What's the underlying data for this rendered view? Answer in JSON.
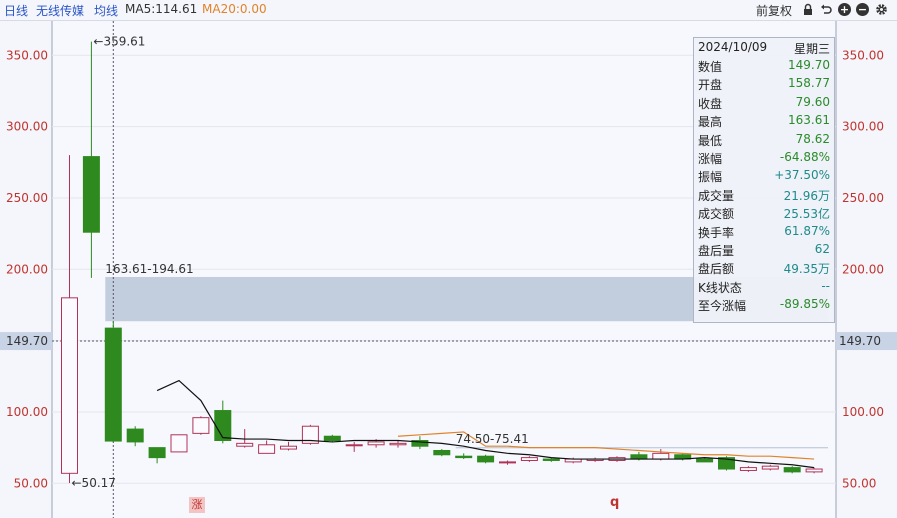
{
  "toolbar": {
    "period": "日线",
    "stock_name": "无线传媒",
    "avg_line": "均线",
    "ma5": "MA5:114.61",
    "ma20": "MA20:0.00",
    "adjust": "前复权"
  },
  "icons": [
    "lock-icon",
    "undo-icon",
    "zoom-in-icon",
    "zoom-out-icon",
    "settings-gear-icon"
  ],
  "info_panel": {
    "date": "2024/10/09",
    "weekday": "星期三",
    "rows": [
      {
        "label": "数值",
        "value": "149.70",
        "color": "#2b8a2b"
      },
      {
        "label": "开盘",
        "value": "158.77",
        "color": "#2b8a2b"
      },
      {
        "label": "收盘",
        "value": "79.60",
        "color": "#2b8a2b"
      },
      {
        "label": "最高",
        "value": "163.61",
        "color": "#2b8a2b"
      },
      {
        "label": "最低",
        "value": "78.62",
        "color": "#2b8a2b"
      },
      {
        "label": "涨幅",
        "value": "-64.88%",
        "color": "#2b8a2b"
      },
      {
        "label": "振幅",
        "value": "+37.50%",
        "color": "#1f8a8a"
      },
      {
        "label": "成交量",
        "value": "21.96万",
        "color": "#1f8a8a"
      },
      {
        "label": "成交额",
        "value": "25.53亿",
        "color": "#1f8a8a"
      },
      {
        "label": "换手率",
        "value": "61.87%",
        "color": "#1f8a8a"
      },
      {
        "label": "盘后量",
        "value": "62",
        "color": "#1f8a8a"
      },
      {
        "label": "盘后额",
        "value": "49.35万",
        "color": "#1f8a8a"
      },
      {
        "label": "K线状态",
        "value": "--",
        "color": "#1f8a8a"
      },
      {
        "label": "至今涨幅",
        "value": "-89.85%",
        "color": "#2b8a2b"
      }
    ]
  },
  "markers": {
    "badge": "涨",
    "q": "q"
  },
  "chart_data": {
    "type": "candlestick",
    "y_ticks": [
      50,
      100,
      150,
      200,
      250,
      300,
      350
    ],
    "y_tick_labels": [
      "50.00",
      "100.00",
      "150.00",
      "200.00",
      "250.00",
      "300.00",
      "350.00"
    ],
    "ylim": [
      41,
      372
    ],
    "grid": true,
    "up_color": "#b03357",
    "down_color": "#2e8a1f",
    "candles": [
      {
        "o": 57,
        "h": 280,
        "l": 50.17,
        "c": 180
      },
      {
        "o": 279,
        "h": 359.61,
        "l": 194,
        "c": 226
      },
      {
        "o": 158.77,
        "h": 163.61,
        "l": 78.62,
        "c": 79.6
      },
      {
        "o": 88,
        "h": 90,
        "l": 76,
        "c": 79
      },
      {
        "o": 75,
        "h": 75,
        "l": 64,
        "c": 68
      },
      {
        "o": 72,
        "h": 84,
        "l": 72,
        "c": 84
      },
      {
        "o": 85,
        "h": 97,
        "l": 84,
        "c": 96
      },
      {
        "o": 101,
        "h": 108,
        "l": 78,
        "c": 80
      },
      {
        "o": 76,
        "h": 88,
        "l": 75,
        "c": 78
      },
      {
        "o": 71,
        "h": 80,
        "l": 71,
        "c": 77
      },
      {
        "o": 74,
        "h": 79,
        "l": 73,
        "c": 76
      },
      {
        "o": 78,
        "h": 91,
        "l": 77,
        "c": 90
      },
      {
        "o": 83,
        "h": 84,
        "l": 79,
        "c": 80
      },
      {
        "o": 77,
        "h": 79,
        "l": 72,
        "c": 77
      },
      {
        "o": 77,
        "h": 81,
        "l": 75,
        "c": 79
      },
      {
        "o": 77,
        "h": 80,
        "l": 75,
        "c": 78
      },
      {
        "o": 80,
        "h": 83,
        "l": 74,
        "c": 76
      },
      {
        "o": 73,
        "h": 74,
        "l": 69,
        "c": 70
      },
      {
        "o": 69,
        "h": 71,
        "l": 67,
        "c": 68
      },
      {
        "o": 69,
        "h": 70,
        "l": 64,
        "c": 65
      },
      {
        "o": 65,
        "h": 66,
        "l": 63,
        "c": 65
      },
      {
        "o": 66,
        "h": 69,
        "l": 65,
        "c": 68
      },
      {
        "o": 67,
        "h": 68,
        "l": 65,
        "c": 66
      },
      {
        "o": 65,
        "h": 68,
        "l": 64,
        "c": 67
      },
      {
        "o": 66,
        "h": 68,
        "l": 65,
        "c": 67
      },
      {
        "o": 66,
        "h": 69,
        "l": 65,
        "c": 68
      },
      {
        "o": 70,
        "h": 72,
        "l": 66,
        "c": 67
      },
      {
        "o": 67,
        "h": 74,
        "l": 66,
        "c": 71
      },
      {
        "o": 70,
        "h": 71,
        "l": 66,
        "c": 67
      },
      {
        "o": 67,
        "h": 68,
        "l": 65,
        "c": 65
      },
      {
        "o": 68,
        "h": 69,
        "l": 59,
        "c": 60
      },
      {
        "o": 59,
        "h": 62,
        "l": 58,
        "c": 61
      },
      {
        "o": 60,
        "h": 63,
        "l": 59,
        "c": 62
      },
      {
        "o": 61,
        "h": 62,
        "l": 57,
        "c": 58
      },
      {
        "o": 58,
        "h": 61,
        "l": 57,
        "c": 60
      }
    ],
    "ma5": [
      null,
      null,
      null,
      null,
      115,
      122,
      108,
      82,
      81,
      81,
      80,
      80,
      79,
      80,
      80,
      80,
      79,
      78,
      76,
      73,
      71,
      70,
      68,
      67,
      67,
      67,
      67,
      67,
      67,
      68,
      67,
      65,
      64,
      63,
      61
    ],
    "ma20": [
      null,
      null,
      null,
      null,
      null,
      null,
      null,
      null,
      null,
      null,
      null,
      null,
      null,
      null,
      null,
      83,
      84,
      85,
      86,
      76,
      76,
      75,
      75,
      75,
      75,
      74,
      73,
      72,
      71,
      70,
      70,
      69,
      69,
      68,
      67
    ],
    "crosshair": {
      "index": 2,
      "value": 149.7,
      "label": "149.70"
    },
    "annotations": [
      {
        "text": "←359.61",
        "x_index": 1,
        "value": 359.61
      },
      {
        "text": "←50.17",
        "x_index": 0,
        "value": 50.17
      },
      {
        "text": "163.61-194.61",
        "x_index": 2,
        "value": 194.61
      },
      {
        "text": "74.50-75.41",
        "x_index": 18,
        "value": 75.41
      }
    ],
    "gaps": [
      {
        "low": 163.61,
        "high": 194.61,
        "from_index": 2
      },
      {
        "low": 74.5,
        "high": 75.41,
        "from_index": 18
      }
    ]
  }
}
